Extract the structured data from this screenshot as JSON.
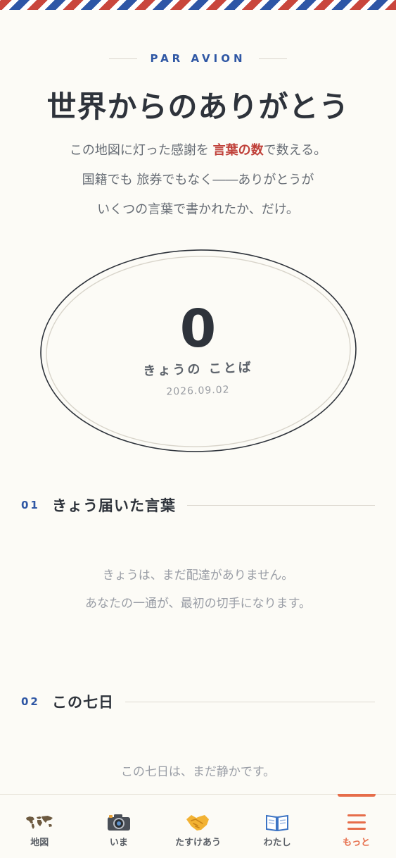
{
  "header": {
    "eyebrow": "PAR AVION",
    "title": "世界からのありがとう"
  },
  "lead": {
    "line1_before": "この地図に灯った感謝を ",
    "line1_accent": "言葉の数",
    "line1_after": "で数える。",
    "line2": "国籍でも 旅券でもなく――ありがとうが",
    "line3": "いくつの言葉で書かれたか、だけ。"
  },
  "stamp": {
    "count": "0",
    "label": "きょうの ことば",
    "date": "2026.09.02"
  },
  "section1": {
    "number": "01",
    "heading": "きょう届いた言葉",
    "empty_line1": "きょうは、まだ配達がありません。",
    "empty_line2": "あなたの一通が、最初の切手になります。"
  },
  "section2": {
    "number": "02",
    "heading": "この七日",
    "empty_line1": "この七日は、まだ静かです。"
  },
  "tabs": [
    {
      "label": "地図",
      "icon": "world-map-icon"
    },
    {
      "label": "いま",
      "icon": "camera-icon"
    },
    {
      "label": "たすけあう",
      "icon": "handshake-icon"
    },
    {
      "label": "わたし",
      "icon": "book-icon"
    },
    {
      "label": "もっと",
      "icon": "menu-icon",
      "active": true
    }
  ],
  "colors": {
    "background": "#fcfbf6",
    "accent_blue": "#2f57a4",
    "accent_red": "#c0413a",
    "active_tab": "#e66d4a"
  }
}
